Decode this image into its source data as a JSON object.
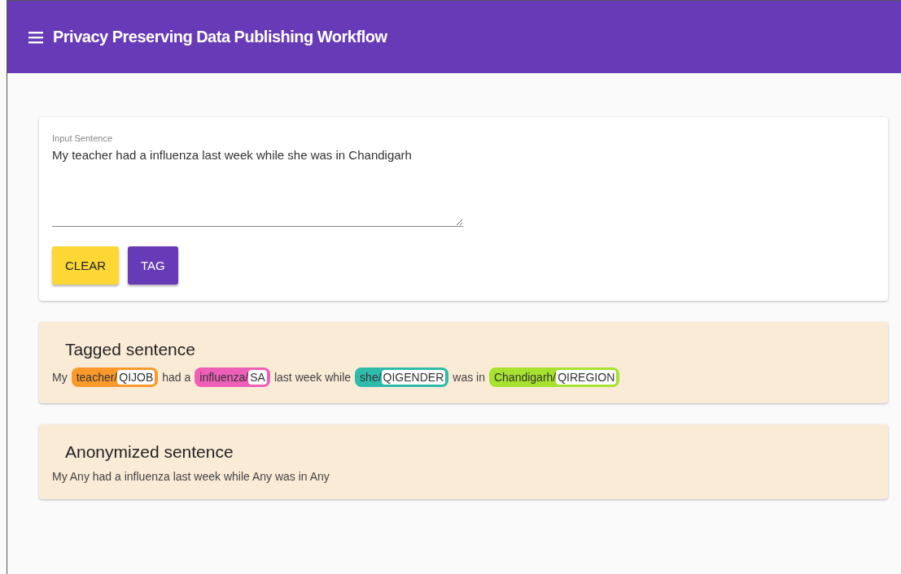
{
  "app_bar": {
    "title": "Privacy Preserving Data Publishing Workflow"
  },
  "input_card": {
    "field": {
      "label": "Input Sentence",
      "value": "My teacher had a influenza last week while she was in Chandigarh"
    },
    "buttons": [
      {
        "label": "CLEAR",
        "kind": "secondary"
      },
      {
        "label": "TAG",
        "kind": "primary"
      }
    ]
  },
  "tagged_card": {
    "title": "Tagged sentence",
    "segments": [
      {
        "kind": "text",
        "text": "My"
      },
      {
        "kind": "tag",
        "word": "teacher/",
        "label": "QIJOB",
        "color": "#fb9a2a"
      },
      {
        "kind": "text",
        "text": "had a"
      },
      {
        "kind": "tag",
        "word": "influenza/",
        "label": "SA",
        "color": "#ee5fb7"
      },
      {
        "kind": "text",
        "text": "last week while"
      },
      {
        "kind": "tag",
        "word": "she/",
        "label": "QIGENDER",
        "color": "#2fbbaa"
      },
      {
        "kind": "text",
        "text": "was in"
      },
      {
        "kind": "tag",
        "word": "Chandigarh/",
        "label": "QIREGION",
        "color": "#a6e22e"
      }
    ]
  },
  "anonymized_card": {
    "title": "Anonymized sentence",
    "text": "My Any had a influenza last week while Any was in Any"
  }
}
